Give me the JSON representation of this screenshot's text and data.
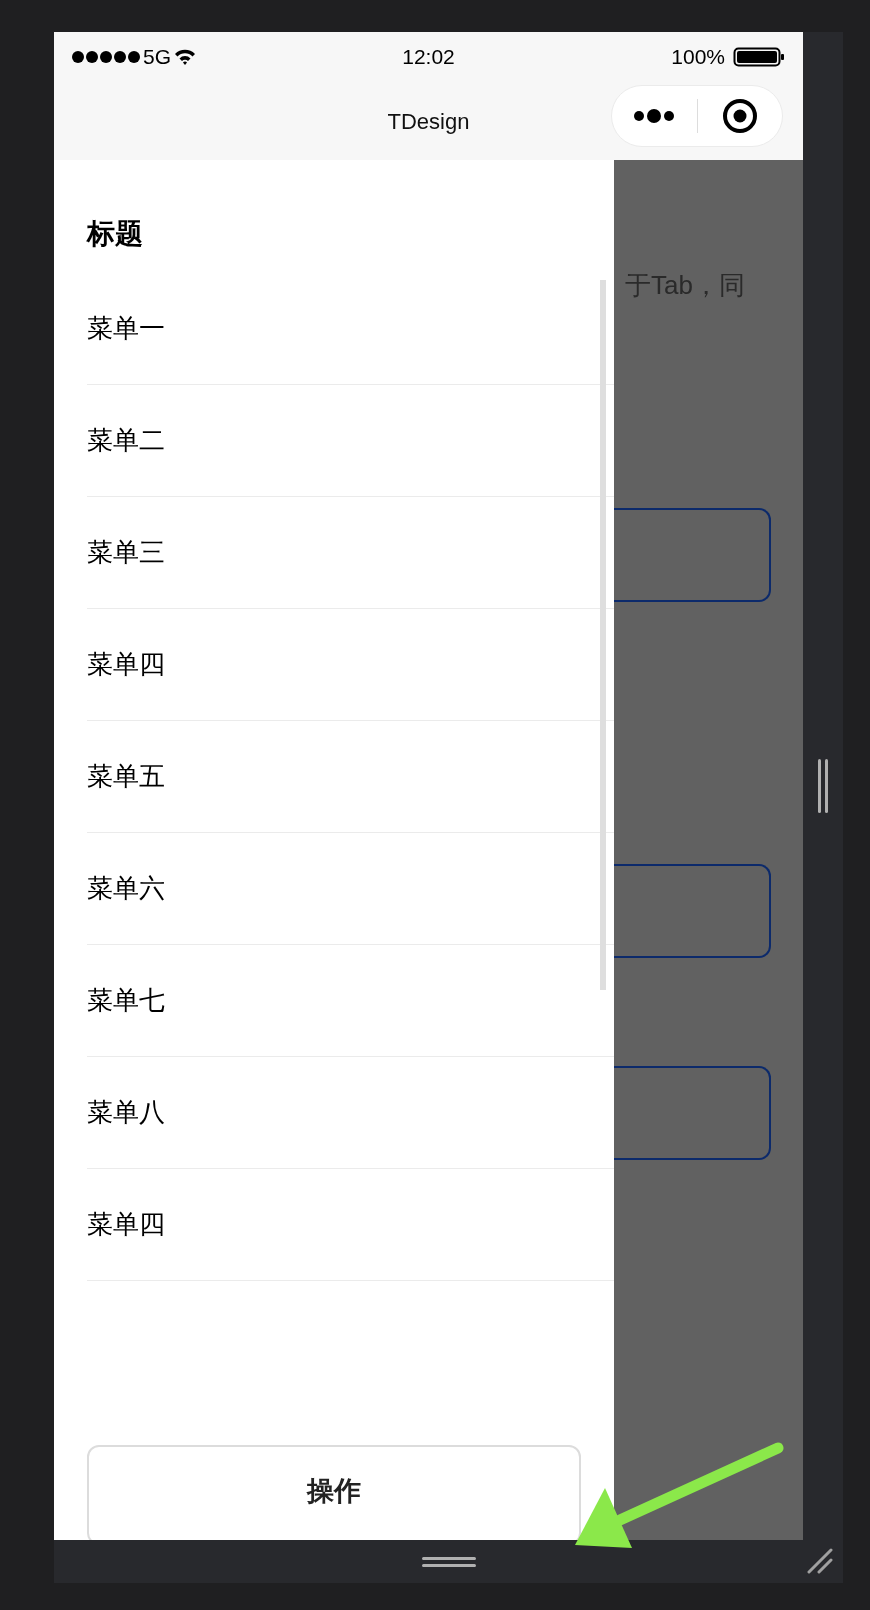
{
  "status_bar": {
    "carrier": "5G",
    "time": "12:02",
    "battery": "100%"
  },
  "nav_bar": {
    "title": "TDesign"
  },
  "drawer": {
    "title": "标题",
    "items": [
      "菜单一",
      "菜单二",
      "菜单三",
      "菜单四",
      "菜单五",
      "菜单六",
      "菜单七",
      "菜单八",
      "菜单四"
    ],
    "action_button": "操作"
  },
  "background": {
    "text": "于Tab，同"
  }
}
